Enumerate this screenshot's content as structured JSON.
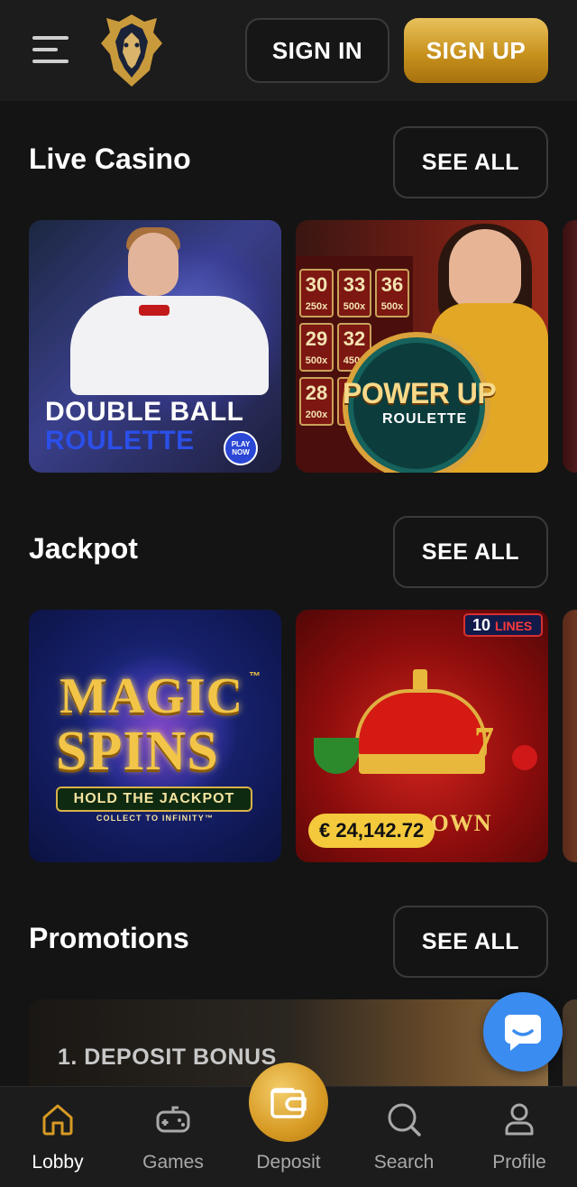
{
  "header": {
    "sign_in": "SIGN IN",
    "sign_up": "SIGN UP"
  },
  "sections": {
    "live_casino": {
      "title": "Live Casino",
      "see_all": "SEE ALL",
      "games": [
        {
          "line1": "DOUBLE BALL",
          "line2": "ROULETTE",
          "badge": "PLAY NOW"
        },
        {
          "line1": "POWER UP",
          "line2": "ROULETTE",
          "board": [
            {
              "num": "30",
              "mult": "250x"
            },
            {
              "num": "33",
              "mult": "500x"
            },
            {
              "num": "36",
              "mult": "500x"
            },
            {
              "num": "29",
              "mult": "500x"
            },
            {
              "num": "32",
              "mult": "450x"
            },
            {
              "num": "28",
              "mult": "200x"
            },
            {
              "num": "31",
              "mult": "150"
            }
          ]
        }
      ]
    },
    "jackpot": {
      "title": "Jackpot",
      "see_all": "SEE ALL",
      "games": [
        {
          "line1": "MAGIC",
          "line2": "SPINS",
          "tm": "™",
          "tagline": "HOLD THE JACKPOT",
          "subtag": "COLLECT TO INFINITY™"
        },
        {
          "lines_num": "10",
          "lines_label": "LINES",
          "name_visible": "CROWN",
          "jackpot_amount": "€ 24,142.72"
        }
      ]
    },
    "promotions": {
      "title": "Promotions",
      "see_all": "SEE ALL",
      "items": [
        {
          "title": "1. DEPOSIT BONUS"
        }
      ]
    }
  },
  "nav": {
    "items": [
      {
        "label": "Lobby",
        "icon": "home-icon",
        "active": true
      },
      {
        "label": "Games",
        "icon": "gamepad-icon"
      },
      {
        "label": "Deposit",
        "icon": "wallet-icon"
      },
      {
        "label": "Search",
        "icon": "search-icon"
      },
      {
        "label": "Profile",
        "icon": "user-icon"
      }
    ]
  },
  "colors": {
    "background": "#141414",
    "accent_gold": "#d79a24",
    "chat_blue": "#3b8cf0"
  }
}
